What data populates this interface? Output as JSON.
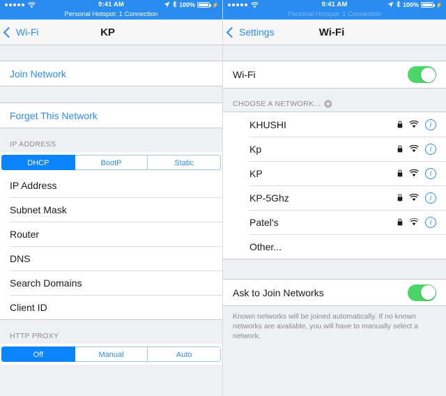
{
  "status_bar": {
    "signal_dots": 5,
    "wifi_icon": "wifi-icon",
    "time": "9:41 AM",
    "location_icon": "location-arrow-icon",
    "bluetooth_icon": "bluetooth-icon",
    "battery_percent": "100%",
    "battery_icon": "battery-full-icon",
    "charging_icon": "lightning-bolt-icon",
    "hotspot_text": "Personal Hotspot: 1 Connection",
    "tint": "#2a8cf0"
  },
  "left_screen": {
    "nav": {
      "back_label": "Wi-Fi",
      "back_icon": "chevron-left-icon",
      "title": "KP"
    },
    "join_network": "Join Network",
    "forget_network": "Forget This Network",
    "ip_address_header": "IP ADDRESS",
    "ip_segmented": {
      "options": [
        "DHCP",
        "BootP",
        "Static"
      ],
      "selected": "DHCP"
    },
    "detail_rows": [
      "IP Address",
      "Subnet Mask",
      "Router",
      "DNS",
      "Search Domains",
      "Client ID"
    ],
    "http_proxy_header": "HTTP PROXY",
    "proxy_segmented": {
      "options": [
        "Off",
        "Manual",
        "Auto"
      ],
      "selected": "Off"
    }
  },
  "right_screen": {
    "nav": {
      "back_label": "Settings",
      "back_icon": "chevron-left-icon",
      "title": "Wi-Fi"
    },
    "wifi_row": {
      "label": "Wi-Fi",
      "toggle_on": true
    },
    "choose_network_header": "CHOOSE A NETWORK...",
    "scanning_spinner": "activity-spinner-icon",
    "networks": [
      {
        "name": "KHUSHI",
        "locked": true,
        "signal": 3,
        "info": true
      },
      {
        "name": "Kp",
        "locked": true,
        "signal": 3,
        "info": true
      },
      {
        "name": "KP",
        "locked": true,
        "signal": 3,
        "info": true
      },
      {
        "name": "KP-5Ghz",
        "locked": true,
        "signal": 3,
        "info": true
      },
      {
        "name": "Patel's",
        "locked": true,
        "signal": 2,
        "info": true
      }
    ],
    "other_label": "Other...",
    "ask_to_join": {
      "label": "Ask to Join Networks",
      "toggle_on": true
    },
    "footnote": "Known networks will be joined automatically. If no known networks are available, you will have to manually select a network."
  },
  "colors": {
    "accent_blue": "#2f8bf2",
    "selected_blue": "#0a84ff",
    "toggle_green": "#4cd568",
    "group_bg": "#eff0f4"
  }
}
